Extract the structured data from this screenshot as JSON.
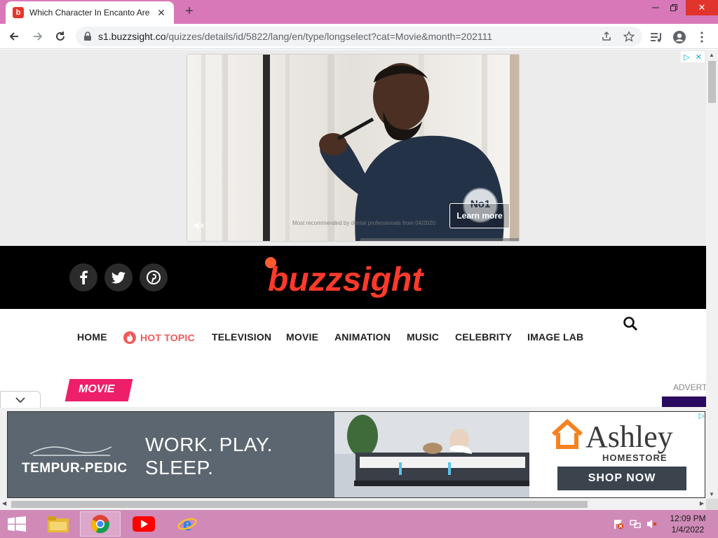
{
  "browser": {
    "tab_title": "Which Character In Encanto Are You?",
    "tab_favicon_letter": "b",
    "url_host": "s1.buzzsight.co",
    "url_path": "/quizzes/details/id/5822/lang/en/type/longselect?cat=Movie&month=202111"
  },
  "top_ad": {
    "caption": "Most recommended by dental professionals from 04/2020",
    "learn_more": "Learn more",
    "badge_text": "No1"
  },
  "site": {
    "logo_text": "buzzsight",
    "social": [
      "facebook",
      "twitter",
      "pinterest"
    ]
  },
  "nav": {
    "items": [
      {
        "label": "HOME"
      },
      {
        "label": "HOT TOPIC"
      },
      {
        "label": "TELEVISION"
      },
      {
        "label": "MOVIE"
      },
      {
        "label": "ANIMATION"
      },
      {
        "label": "MUSIC"
      },
      {
        "label": "CELEBRITY"
      },
      {
        "label": "IMAGE LAB"
      }
    ]
  },
  "content": {
    "category_badge": "MOVIE",
    "advert_label": "ADVERT"
  },
  "bottom_ad": {
    "brand_left": "TEMPUR-PEDIC",
    "headline_1": "WORK. PLAY.",
    "headline_2": "SLEEP.",
    "brand_right": "Ashley",
    "brand_right_sub": "HOMESTORE",
    "cta": "SHOP NOW"
  },
  "taskbar": {
    "time": "12:09 PM",
    "date": "1/4/2022"
  },
  "colors": {
    "brand_accent": "#ee1f6a",
    "hot_topic": "#f05a5a",
    "tabstrip": "#d978b8",
    "taskbar": "#d08ab8"
  }
}
